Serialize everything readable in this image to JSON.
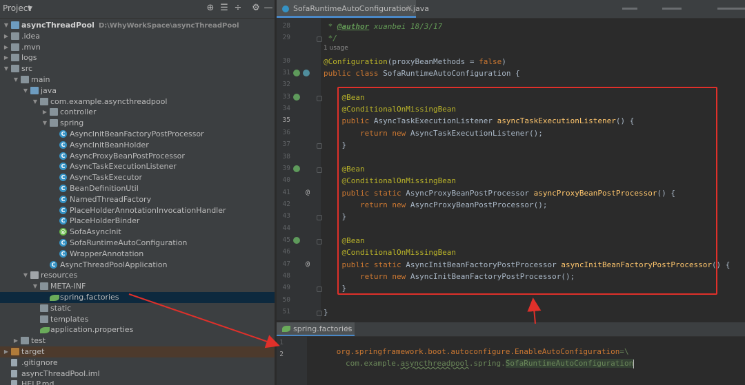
{
  "project_panel": {
    "title": "Project",
    "tree": [
      {
        "label": "asyncThreadPool",
        "hint": "D:\\WhyWorkSpace\\asyncThreadPool",
        "level": 0,
        "icon": "folder-blue",
        "arrow": "down",
        "bold": true
      },
      {
        "label": ".idea",
        "level": 0,
        "icon": "folder",
        "arrow": "right"
      },
      {
        "label": ".mvn",
        "level": 0,
        "icon": "folder",
        "arrow": "right"
      },
      {
        "label": "logs",
        "level": 0,
        "icon": "folder",
        "arrow": "right"
      },
      {
        "label": "src",
        "level": 0,
        "icon": "folder",
        "arrow": "down"
      },
      {
        "label": "main",
        "level": 1,
        "icon": "folder",
        "arrow": "down"
      },
      {
        "label": "java",
        "level": 2,
        "icon": "folder-blue",
        "arrow": "down"
      },
      {
        "label": "com.example.asyncthreadpool",
        "level": 3,
        "icon": "package",
        "arrow": "down"
      },
      {
        "label": "controller",
        "level": 4,
        "icon": "package",
        "arrow": "right"
      },
      {
        "label": "spring",
        "level": 4,
        "icon": "package",
        "arrow": "down"
      },
      {
        "label": "AsyncInitBeanFactoryPostProcessor",
        "level": 5,
        "icon": "class"
      },
      {
        "label": "AsyncInitBeanHolder",
        "level": 5,
        "icon": "class"
      },
      {
        "label": "AsyncProxyBeanPostProcessor",
        "level": 5,
        "icon": "class"
      },
      {
        "label": "AsyncTaskExecutionListener",
        "level": 5,
        "icon": "class"
      },
      {
        "label": "AsyncTaskExecutor",
        "level": 5,
        "icon": "class"
      },
      {
        "label": "BeanDefinitionUtil",
        "level": 5,
        "icon": "class"
      },
      {
        "label": "NamedThreadFactory",
        "level": 5,
        "icon": "class"
      },
      {
        "label": "PlaceHolderAnnotationInvocationHandler",
        "level": 5,
        "icon": "class"
      },
      {
        "label": "PlaceHolderBinder",
        "level": 5,
        "icon": "class"
      },
      {
        "label": "SofaAsyncInit",
        "level": 5,
        "icon": "annotation"
      },
      {
        "label": "SofaRuntimeAutoConfiguration",
        "level": 5,
        "icon": "class"
      },
      {
        "label": "WrapperAnnotation",
        "level": 5,
        "icon": "class"
      },
      {
        "label": "AsyncThreadPoolApplication",
        "level": 4,
        "icon": "app"
      },
      {
        "label": "resources",
        "level": 2,
        "icon": "resources",
        "arrow": "down"
      },
      {
        "label": "META-INF",
        "level": 3,
        "icon": "folder",
        "arrow": "down"
      },
      {
        "label": "spring.factories",
        "level": 4,
        "icon": "spring",
        "selected": true
      },
      {
        "label": "static",
        "level": 3,
        "icon": "folder"
      },
      {
        "label": "templates",
        "level": 3,
        "icon": "folder"
      },
      {
        "label": "application.properties",
        "level": 3,
        "icon": "spring"
      },
      {
        "label": "test",
        "level": 1,
        "icon": "folder",
        "arrow": "right"
      },
      {
        "label": "target",
        "level": 0,
        "icon": "folder-target",
        "arrow": "right",
        "highlight": true
      },
      {
        "label": ".gitignore",
        "level": 0,
        "icon": "file"
      },
      {
        "label": "asyncThreadPool.iml",
        "level": 0,
        "icon": "file"
      },
      {
        "label": "HELP.md",
        "level": 0,
        "icon": "file"
      }
    ]
  },
  "editor": {
    "tab_label": "SofaRuntimeAutoConfiguration.java",
    "usage_hint": "1 usage",
    "lines": [
      {
        "n": "28",
        "parts": [
          [
            "cm",
            " * "
          ],
          [
            "cmtag",
            "@author"
          ],
          [
            "cm",
            " xuanbei 18/3/17"
          ]
        ]
      },
      {
        "n": "29",
        "parts": [
          [
            "cm",
            " */"
          ]
        ]
      },
      {
        "n": "30",
        "parts": [
          [
            "an",
            "@Configuration"
          ],
          [
            "",
            "(proxyBeanMethods = "
          ],
          [
            "kw",
            "false"
          ],
          [
            "",
            ")"
          ]
        ]
      },
      {
        "n": "31",
        "parts": [
          [
            "kw",
            "public class "
          ],
          [
            "",
            "SofaRuntimeAutoConfiguration {"
          ]
        ]
      },
      {
        "n": "32",
        "parts": []
      },
      {
        "n": "33",
        "parts": [
          [
            "an",
            "    @Bean"
          ]
        ]
      },
      {
        "n": "34",
        "parts": [
          [
            "an",
            "    @ConditionalOnMissingBean"
          ]
        ]
      },
      {
        "n": "35",
        "parts": [
          [
            "kw",
            "    public "
          ],
          [
            "",
            "AsyncTaskExecutionListener "
          ],
          [
            "fn",
            "asyncTaskExecutionListener"
          ],
          [
            "",
            "() {"
          ]
        ]
      },
      {
        "n": "36",
        "parts": [
          [
            "kw",
            "        return new "
          ],
          [
            "",
            "AsyncTaskExecutionListener();"
          ]
        ]
      },
      {
        "n": "37",
        "parts": [
          [
            "",
            "    }"
          ]
        ]
      },
      {
        "n": "38",
        "parts": []
      },
      {
        "n": "39",
        "parts": [
          [
            "an",
            "    @Bean"
          ]
        ]
      },
      {
        "n": "40",
        "parts": [
          [
            "an",
            "    @ConditionalOnMissingBean"
          ]
        ]
      },
      {
        "n": "41",
        "parts": [
          [
            "kw",
            "    public static "
          ],
          [
            "",
            "AsyncProxyBeanPostProcessor "
          ],
          [
            "fn",
            "asyncProxyBeanPostProcessor"
          ],
          [
            "",
            "() {"
          ]
        ]
      },
      {
        "n": "42",
        "parts": [
          [
            "kw",
            "        return new "
          ],
          [
            "",
            "AsyncProxyBeanPostProcessor();"
          ]
        ]
      },
      {
        "n": "43",
        "parts": [
          [
            "",
            "    }"
          ]
        ]
      },
      {
        "n": "44",
        "parts": []
      },
      {
        "n": "45",
        "parts": [
          [
            "an",
            "    @Bean"
          ]
        ]
      },
      {
        "n": "46",
        "parts": [
          [
            "an",
            "    @ConditionalOnMissingBean"
          ]
        ]
      },
      {
        "n": "47",
        "parts": [
          [
            "kw",
            "    public static "
          ],
          [
            "",
            "AsyncInitBeanFactoryPostProcessor "
          ],
          [
            "fn",
            "asyncInitBeanFactoryPostProcessor"
          ],
          [
            "",
            "() {"
          ]
        ]
      },
      {
        "n": "48",
        "parts": [
          [
            "kw",
            "        return new "
          ],
          [
            "",
            "AsyncInitBeanFactoryPostProcessor();"
          ]
        ]
      },
      {
        "n": "49",
        "parts": [
          [
            "",
            "    }"
          ]
        ]
      },
      {
        "n": "50",
        "parts": []
      },
      {
        "n": "51",
        "parts": [
          [
            "",
            "}"
          ]
        ]
      }
    ],
    "gutter_marks": {
      "bean_lines": [
        "33",
        "39",
        "45"
      ],
      "override_lines": [
        "41",
        "47"
      ]
    }
  },
  "factories_editor": {
    "tab_label": "spring.factories",
    "lines": [
      {
        "n": "1",
        "key": "org.springframework.boot.autoconfigure.EnableAutoConfiguration",
        "sep": "=\\"
      },
      {
        "n": "2",
        "value_pre": "  com.example.",
        "value_spell": "asyncthreadpool",
        "value_mid": ".spring.",
        "value_sel": "SofaRuntimeAutoConfiguration"
      }
    ]
  },
  "colors": {
    "annotation_box": "#e0302a",
    "arrow": "#e0302a"
  }
}
